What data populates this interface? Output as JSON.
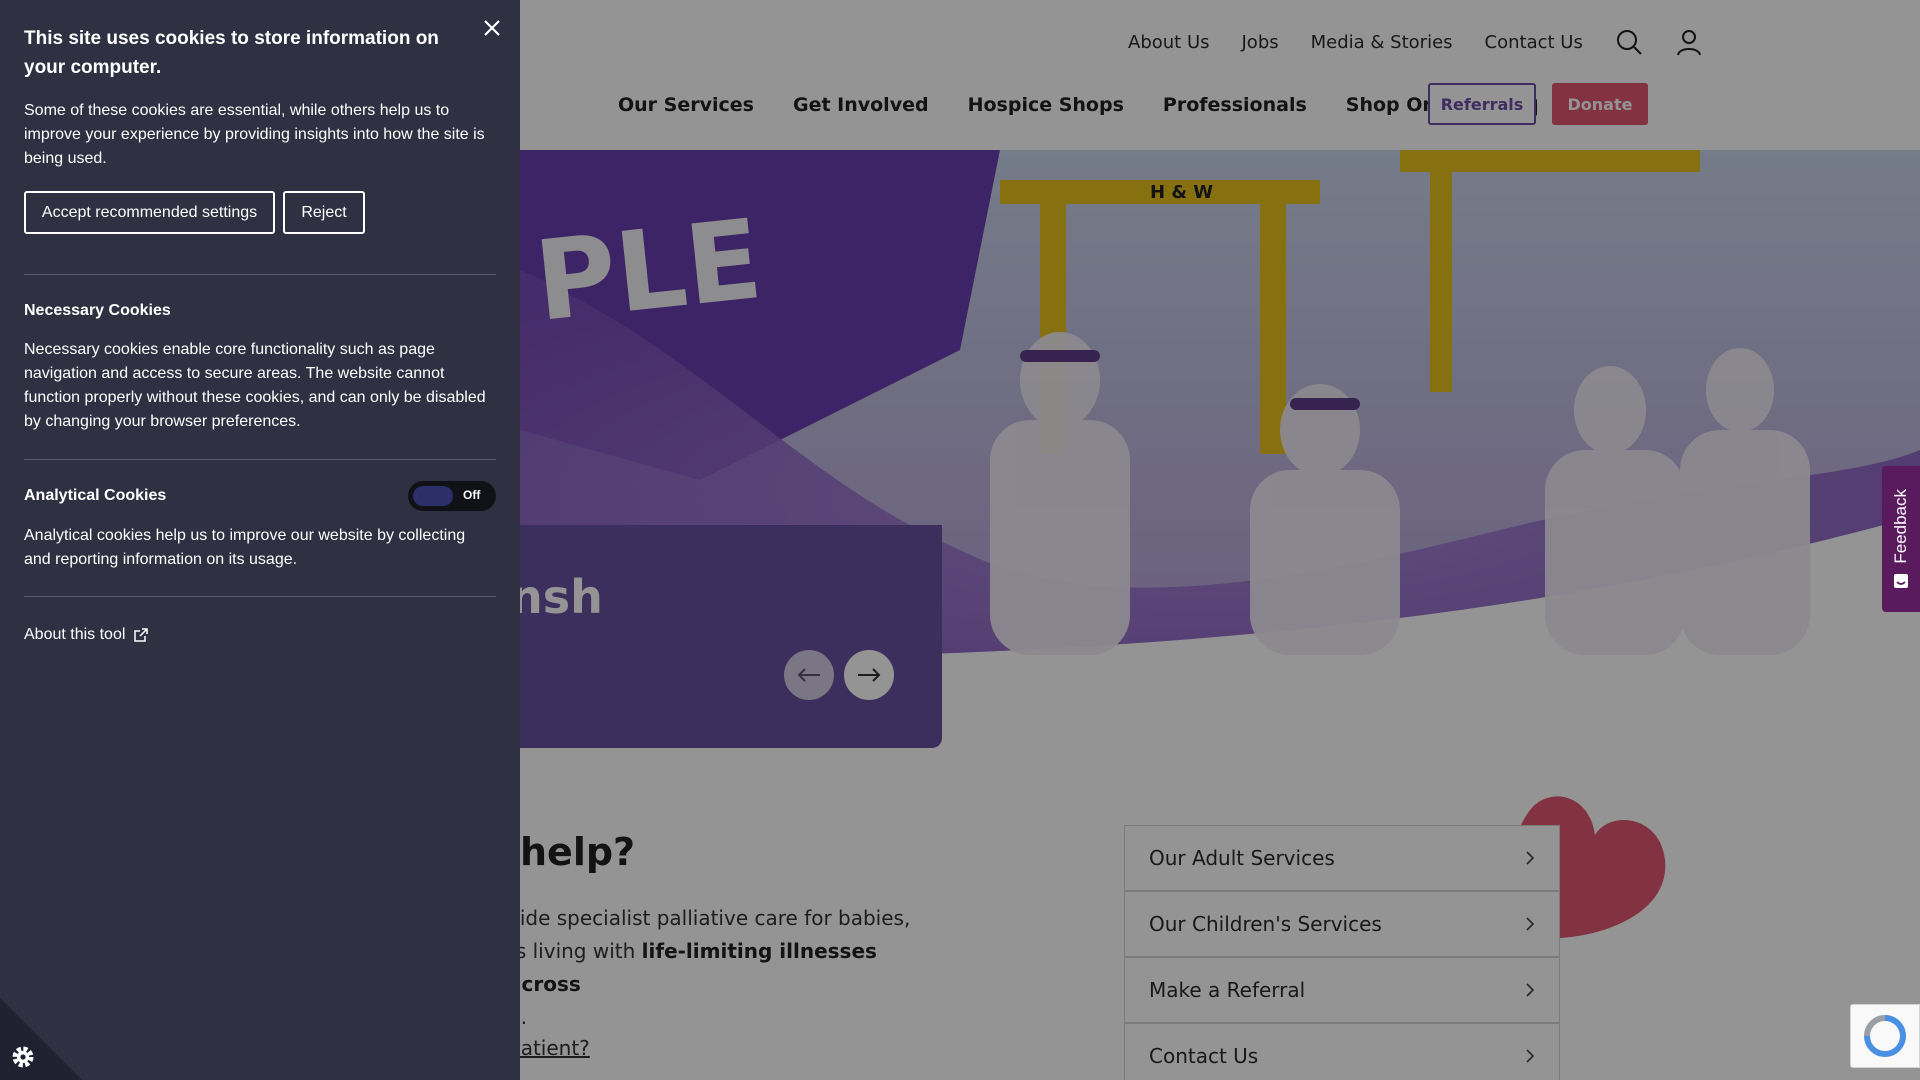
{
  "header": {
    "top_links": [
      "About Us",
      "Jobs",
      "Media & Stories",
      "Contact Us"
    ],
    "main_nav": [
      "Our Services",
      "Get Involved",
      "Hospice Shops",
      "Professionals",
      "Shop Online"
    ],
    "referrals_label": "Referrals",
    "donate_label": "Donate",
    "icons": [
      "search-icon",
      "user-icon",
      "shopping-bag-icon"
    ]
  },
  "hero": {
    "title_fragment": "nsh",
    "banner_fragment": "PLE",
    "crane_text": "H & W"
  },
  "help": {
    "heading_fragment": "help?",
    "line1": "vide specialist palliative care for babies,",
    "line2_plain": "ts living with ",
    "line2_bold": "life-limiting illnesses across",
    "line3": "d.",
    "link_fragment": "patient?"
  },
  "services": [
    "Our Adult Services",
    "Our Children's Services",
    "Make a Referral",
    "Contact Us"
  ],
  "feedback_label": "Feedback",
  "cookie": {
    "title": "This site uses cookies to store information on your computer.",
    "intro": "Some of these cookies are essential, while others help us to improve your experience by providing insights into how the site is being used.",
    "accept_label": "Accept recommended settings",
    "reject_label": "Reject",
    "necessary_heading": "Necessary Cookies",
    "necessary_text": "Necessary cookies enable core functionality such as page navigation and access to secure areas. The website cannot function properly without these cookies, and can only be disabled by changing your browser preferences.",
    "analytical_heading": "Analytical Cookies",
    "analytical_toggle": "Off",
    "analytical_text": "Analytical cookies help us to improve our website by collecting and reporting information on its usage.",
    "about_label": "About this tool"
  },
  "colors": {
    "panel": "#2f3041",
    "brand_purple": "#6a51a0",
    "donate_pink": "#e0566f"
  }
}
